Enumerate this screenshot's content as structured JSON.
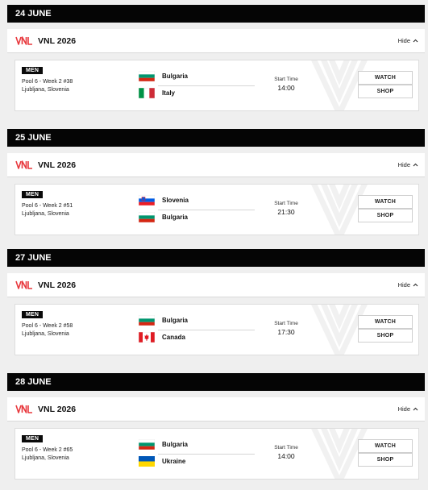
{
  "days": [
    {
      "date": "24 JUNE",
      "competition": "VNL 2026",
      "hide_label": "Hide",
      "match": {
        "gender": "MEN",
        "pool_line": "Pool 6 - Week 2 #38",
        "venue": "Ljubljana, Slovenia",
        "team1": "Bulgaria",
        "flag1": "bulgaria-flag",
        "team2": "Italy",
        "flag2": "italy-flag",
        "start_label": "Start Time",
        "time": "14:00",
        "watch_label": "WATCH",
        "shop_label": "SHOP"
      }
    },
    {
      "date": "25 JUNE",
      "competition": "VNL 2026",
      "hide_label": "Hide",
      "match": {
        "gender": "MEN",
        "pool_line": "Pool 6 - Week 2 #51",
        "venue": "Ljubljana, Slovenia",
        "team1": "Slovenia",
        "flag1": "slovenia-flag",
        "team2": "Bulgaria",
        "flag2": "bulgaria-flag",
        "start_label": "Start Time",
        "time": "21:30",
        "watch_label": "WATCH",
        "shop_label": "SHOP"
      }
    },
    {
      "date": "27 JUNE",
      "competition": "VNL 2026",
      "hide_label": "Hide",
      "match": {
        "gender": "MEN",
        "pool_line": "Pool 6 - Week 2 #58",
        "venue": "Ljubljana, Slovenia",
        "team1": "Bulgaria",
        "flag1": "bulgaria-flag",
        "team2": "Canada",
        "flag2": "canada-flag",
        "start_label": "Start Time",
        "time": "17:30",
        "watch_label": "WATCH",
        "shop_label": "SHOP"
      }
    },
    {
      "date": "28 JUNE",
      "competition": "VNL 2026",
      "hide_label": "Hide",
      "match": {
        "gender": "MEN",
        "pool_line": "Pool 6 - Week 2 #65",
        "venue": "Ljubljana, Slovenia",
        "team1": "Bulgaria",
        "flag1": "bulgaria-flag",
        "team2": "Ukraine",
        "flag2": "ukraine-flag",
        "start_label": "Start Time",
        "time": "14:00",
        "watch_label": "WATCH",
        "shop_label": "SHOP"
      }
    }
  ],
  "colors": {
    "day_bar": "#050505",
    "brand_logo": "#e8383d",
    "page_bg": "#efefef"
  }
}
